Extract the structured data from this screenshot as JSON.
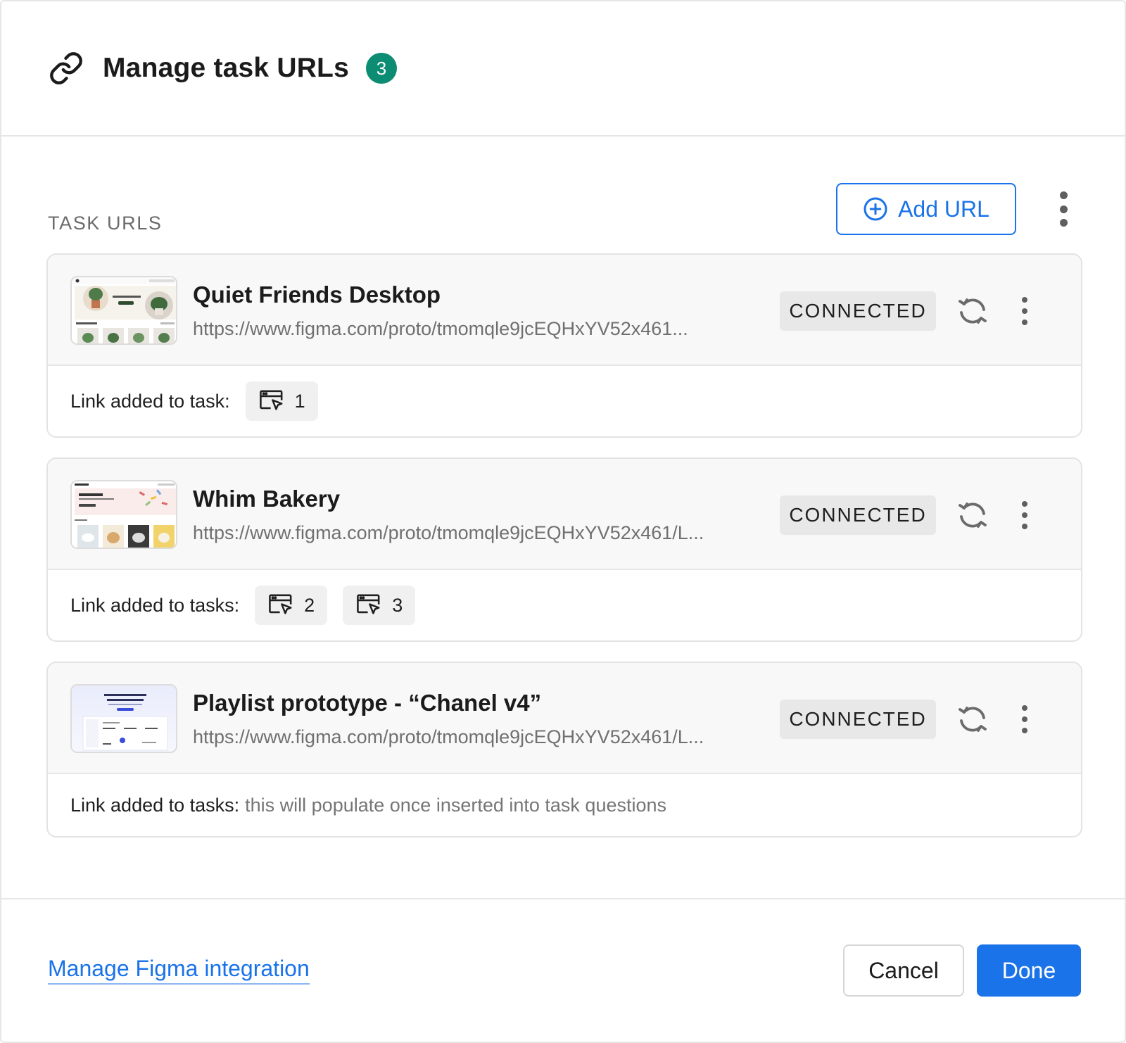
{
  "header": {
    "title": "Manage task URLs",
    "count": "3",
    "icon": "link-icon"
  },
  "section": {
    "label": "TASK URLS",
    "add_url_label": "Add URL",
    "add_url_icon": "plus-circle-icon"
  },
  "urls": [
    {
      "name": "Quiet Friends Desktop",
      "url": "https://www.figma.com/proto/tmomqle9jcEQHxYV52x461...",
      "status": "CONNECTED",
      "link_label": "Link added to task:",
      "tasks": [
        "1"
      ],
      "placeholder": ""
    },
    {
      "name": "Whim Bakery",
      "url": "https://www.figma.com/proto/tmomqle9jcEQHxYV52x461/L...",
      "status": "CONNECTED",
      "link_label": "Link added to tasks:",
      "tasks": [
        "2",
        "3"
      ],
      "placeholder": ""
    },
    {
      "name": "Playlist prototype - “Chanel v4”",
      "url": "https://www.figma.com/proto/tmomqle9jcEQHxYV52x461/L...",
      "status": "CONNECTED",
      "link_label": "Link added to tasks:",
      "tasks": [],
      "placeholder": "this will populate once inserted into task questions"
    }
  ],
  "footer": {
    "manage_link": "Manage Figma integration",
    "cancel_label": "Cancel",
    "done_label": "Done"
  },
  "colors": {
    "accent": "#1a73e8",
    "badge": "#0c8c73",
    "status_bg": "#e8e8e8"
  }
}
